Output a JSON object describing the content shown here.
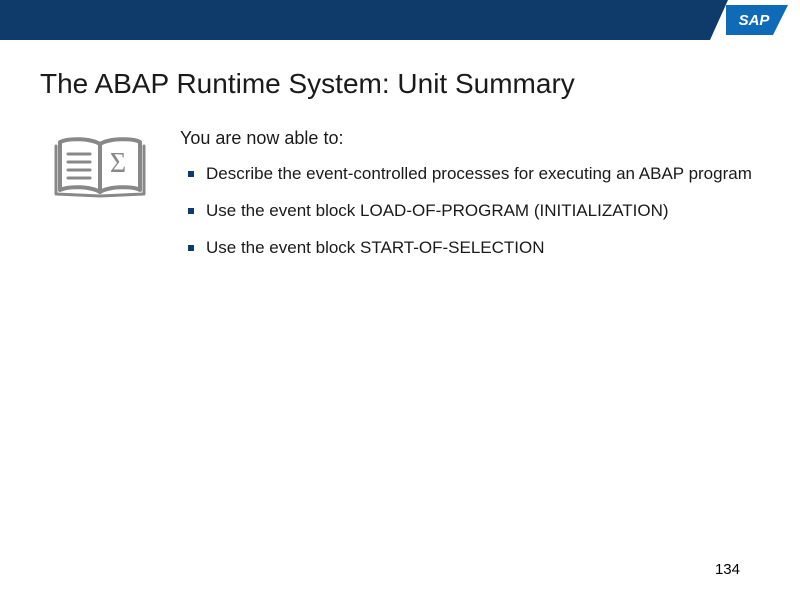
{
  "header": {
    "logo_text": "SAP"
  },
  "title": "The ABAP Runtime System: Unit Summary",
  "content": {
    "intro": "You are now able to:",
    "bullets": [
      "Describe the event-controlled processes for executing an ABAP program",
      "Use the event block LOAD-OF-PROGRAM (INITIALIZATION)",
      "Use the event block START-OF-SELECTION"
    ]
  },
  "page_number": "134"
}
